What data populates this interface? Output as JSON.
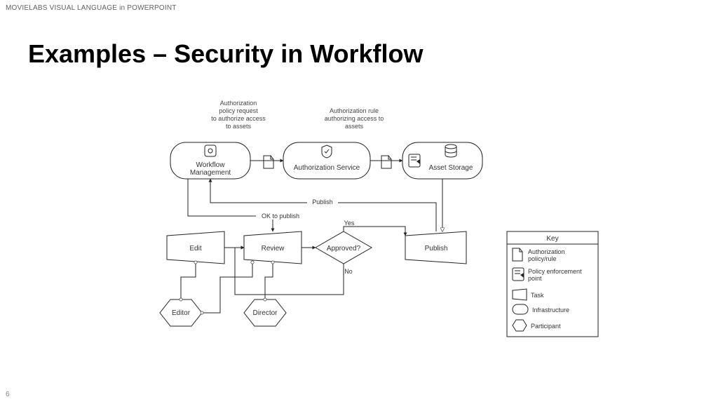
{
  "header_small": "MOVIELABS VISUAL LANGUAGE in POWERPOINT",
  "title": "Examples – Security in Workflow",
  "page_number": "6",
  "annotations": {
    "auth_policy_request_l1": "Authorization",
    "auth_policy_request_l2": "policy request",
    "auth_policy_request_l3": "to authorize access",
    "auth_policy_request_l4": "to assets",
    "auth_rule_l1": "Authorization rule",
    "auth_rule_l2": "authorizing access to",
    "auth_rule_l3": "assets"
  },
  "nodes": {
    "workflow_mgmt_l1": "Workflow",
    "workflow_mgmt_l2": "Management",
    "auth_service": "Authorization Service",
    "asset_storage": "Asset Storage",
    "edit": "Edit",
    "review": "Review",
    "approved": "Approved?",
    "publish": "Publish",
    "editor": "Editor",
    "director": "Director"
  },
  "flows": {
    "publish": "Publish",
    "ok_to_publish": "OK to publish",
    "yes": "Yes",
    "no": "No"
  },
  "key": {
    "title": "Key",
    "auth_policy_l1": "Authorization",
    "auth_policy_l2": "policy/rule",
    "pep_l1": "Policy enforcement",
    "pep_l2": "point",
    "task": "Task",
    "infrastructure": "Infrastructure",
    "participant": "Participant"
  }
}
